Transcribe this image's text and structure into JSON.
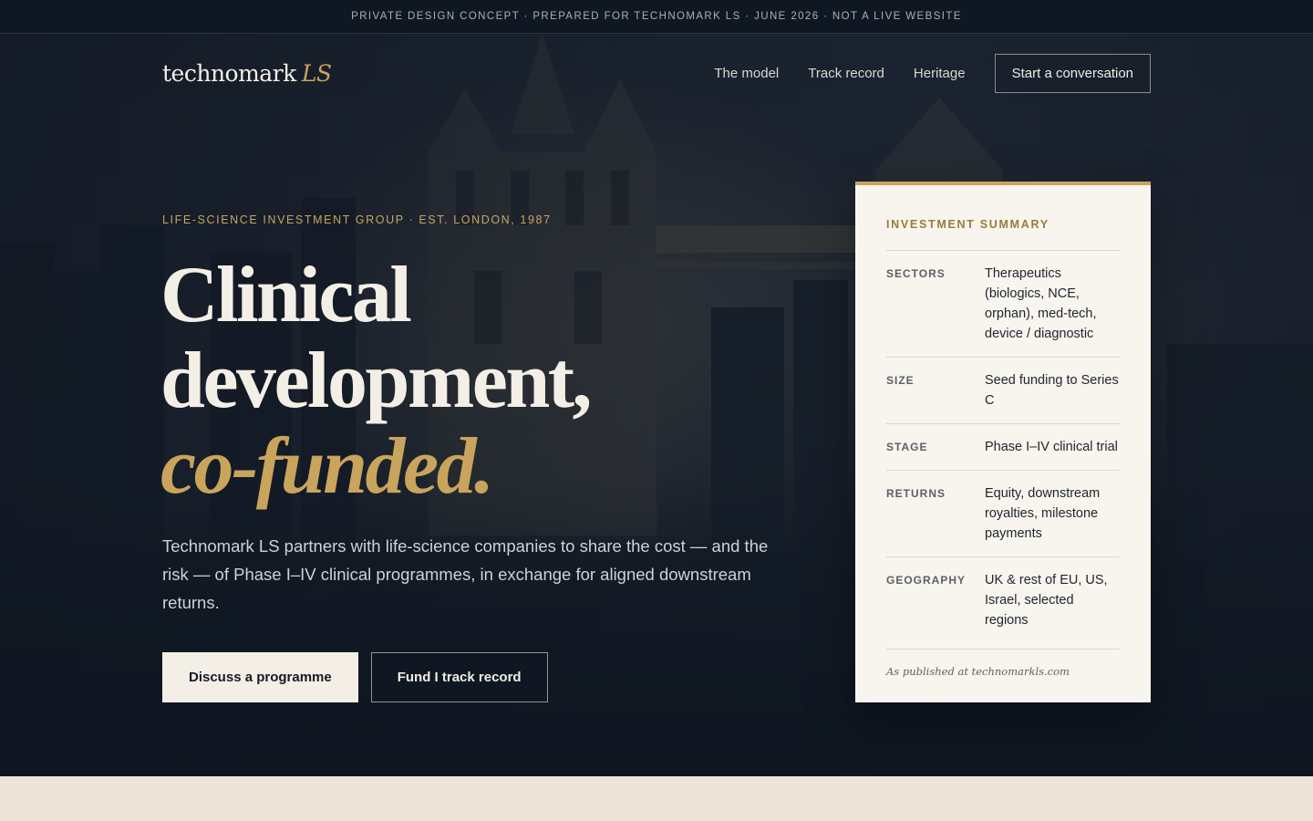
{
  "notice": "PRIVATE DESIGN CONCEPT · PREPARED FOR TECHNOMARK LS · JUNE 2026 · NOT A LIVE WEBSITE",
  "brand": {
    "name": "technomark",
    "accent": "LS"
  },
  "nav": {
    "links": [
      "The model",
      "Track record",
      "Heritage"
    ],
    "cta": "Start a conversation"
  },
  "hero": {
    "eyebrow": "LIFE-SCIENCE INVESTMENT GROUP · EST. LONDON, 1987",
    "headline": {
      "line1": "Clinical",
      "line2": "development,",
      "line3": "co-funded."
    },
    "lede": "Technomark LS partners with life-science companies to share the cost — and the risk — of Phase I–IV clinical programmes, in exchange for aligned downstream returns.",
    "primary_button": "Discuss a programme",
    "secondary_button": "Fund I track record"
  },
  "summary": {
    "title": "INVESTMENT SUMMARY",
    "rows": [
      {
        "label": "SECTORS",
        "value": "Therapeutics (biologics, NCE, orphan), med-tech, device / diagnostic"
      },
      {
        "label": "SIZE",
        "value": "Seed funding to Series C"
      },
      {
        "label": "STAGE",
        "value": "Phase I–IV clinical trial"
      },
      {
        "label": "RETURNS",
        "value": "Equity, downstream royalties, milestone payments"
      },
      {
        "label": "GEOGRAPHY",
        "value": "UK & rest of EU, US, Israel, selected regions"
      }
    ],
    "footnote": "As published at technomarkls.com"
  },
  "colors": {
    "gold": "#c9a45c",
    "navy": "#0f1722",
    "cream": "#f8f5ee",
    "band": "#ece5d8"
  }
}
